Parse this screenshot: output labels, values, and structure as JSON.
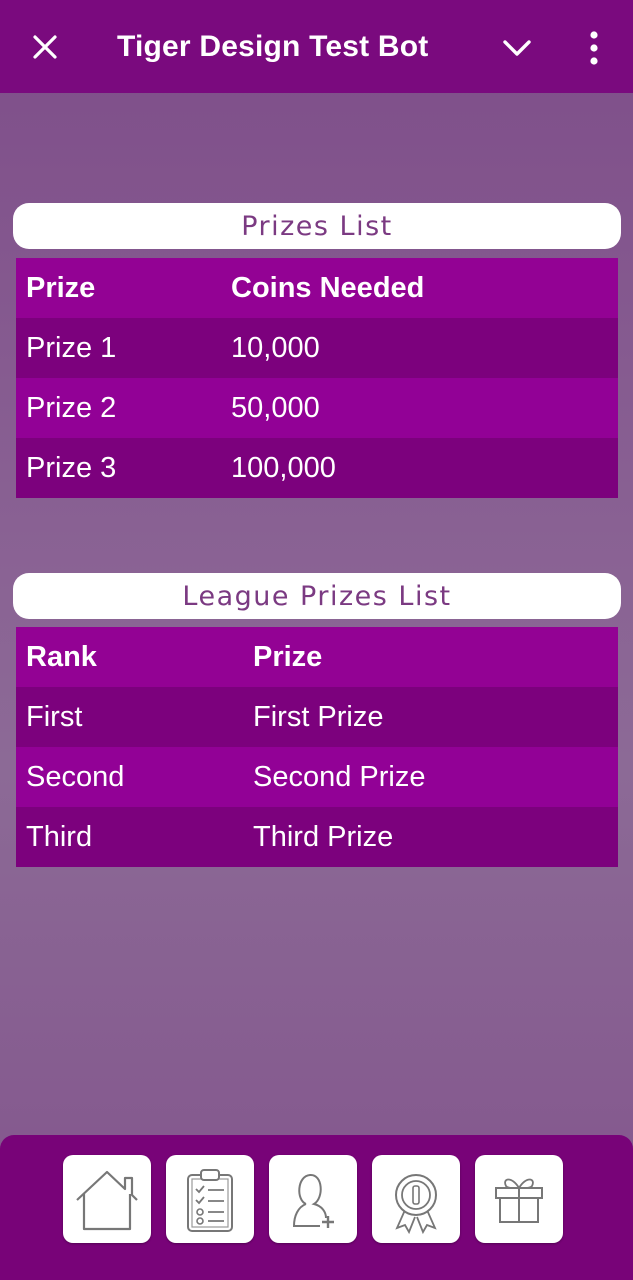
{
  "header": {
    "title": "Tiger Design Test Bot",
    "icons": [
      "close-icon",
      "chevron-down-icon",
      "more-vertical-icon"
    ]
  },
  "prizes": {
    "title": "Prizes List",
    "columns": [
      "Prize",
      "Coins Needed"
    ],
    "rows": [
      [
        "Prize 1",
        "10,000"
      ],
      [
        "Prize 2",
        "50,000"
      ],
      [
        "Prize 3",
        "100,000"
      ]
    ]
  },
  "league": {
    "title": "League Prizes List",
    "columns": [
      "Rank",
      "Prize"
    ],
    "rows": [
      [
        "First",
        "First Prize"
      ],
      [
        "Second",
        "Second Prize"
      ],
      [
        "Third",
        "Third Prize"
      ]
    ]
  },
  "bottom_nav": {
    "icons": [
      "home-icon",
      "clipboard-checklist-icon",
      "add-user-icon",
      "award-badge-icon",
      "gift-icon"
    ]
  },
  "colors": {
    "header_bg": "#7a0a7e",
    "table_header": "#930294",
    "row_dark": "#7c017d",
    "row_light": "#920196",
    "pill_text": "#7b3a82"
  }
}
